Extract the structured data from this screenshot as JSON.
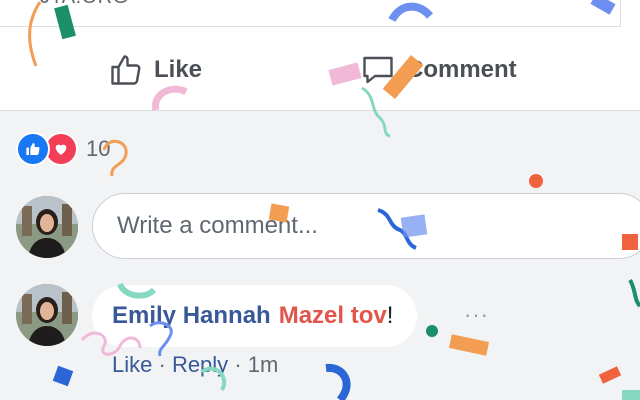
{
  "link": {
    "domain": "JTA.ORG"
  },
  "actions": {
    "like_label": "Like",
    "comment_label": "Comment"
  },
  "reactions": {
    "count": "10"
  },
  "comment_box": {
    "placeholder": "Write a comment..."
  },
  "comment": {
    "author": "Emily Hannah",
    "text": "Mazel tov",
    "text_end": "!",
    "more": "···",
    "like_label": "Like",
    "separator": "·",
    "reply_label": "Reply",
    "time": "1m"
  },
  "colors": {
    "brand": "#1877f2",
    "love": "#f33e58",
    "author": "#385898",
    "mazel": "#e2554a"
  }
}
